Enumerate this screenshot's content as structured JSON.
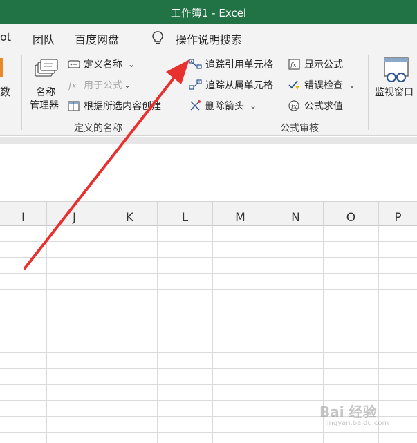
{
  "window": {
    "title": "工作簿1  -  Excel"
  },
  "menu": {
    "tabs": [
      "ot",
      "团队",
      "百度网盘"
    ],
    "tell_me": "操作说明搜索"
  },
  "ribbon": {
    "left_partial": "数",
    "defined_names": {
      "name_manager_line1": "名称",
      "name_manager_line2": "管理器",
      "define_name": "定义名称",
      "use_in_formula": "用于公式",
      "create_from_selection": "根据所选内容创建",
      "group_label": "定义的名称"
    },
    "formula_auditing": {
      "trace_precedents": "追踪引用单元格",
      "trace_dependents": "追踪从属单元格",
      "remove_arrows": "删除箭头",
      "show_formulas": "显示公式",
      "error_checking": "错误检查",
      "evaluate_formula": "公式求值",
      "watch_window": "监视窗口",
      "group_label": "公式审核"
    }
  },
  "columns": [
    "I",
    "J",
    "K",
    "L",
    "M",
    "N",
    "O",
    "P"
  ],
  "watermark": {
    "text": "Bai 经验",
    "sub": "jingyan.baidu.com"
  },
  "colors": {
    "title_bar": "#217346",
    "ribbon_bg": "#f3f3f3",
    "arrow": "#e8312f"
  }
}
